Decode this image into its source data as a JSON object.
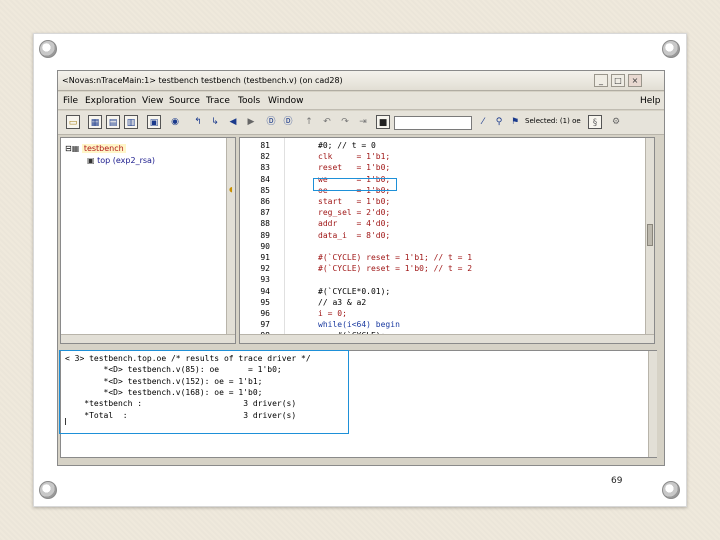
{
  "slide": {
    "page_number": "69"
  },
  "window": {
    "title": "<Novas:nTraceMain:1> testbench testbench (testbench.v) (on cad28)",
    "controls": [
      "_",
      "□",
      "×"
    ]
  },
  "menubar": {
    "items": [
      {
        "label": "File"
      },
      {
        "label": "Exploration"
      },
      {
        "label": "View"
      },
      {
        "label": "Source"
      },
      {
        "label": "Trace"
      },
      {
        "label": "Tools"
      },
      {
        "label": "Window"
      }
    ],
    "help": "Help"
  },
  "toolbar": {
    "selected_label": "Selected: (1) oe",
    "input_value": ""
  },
  "tree": {
    "root": "testbench",
    "child": "top (exp2_rsa)"
  },
  "source": {
    "lines": [
      {
        "num": "81",
        "code": "#0; // t = 0",
        "style": "kw"
      },
      {
        "num": "82",
        "code": "clk     = 1'b1;",
        "style": "red"
      },
      {
        "num": "83",
        "code": "reset   = 1'b0;",
        "style": "red"
      },
      {
        "num": "84",
        "code": "we      = 1'b0;",
        "style": "red"
      },
      {
        "num": "85",
        "code": "oe      = 1'b0;",
        "style": "red"
      },
      {
        "num": "86",
        "code": "start   = 1'b0;",
        "style": "red"
      },
      {
        "num": "87",
        "code": "reg_sel = 2'd0;",
        "style": "red"
      },
      {
        "num": "88",
        "code": "addr    = 4'd0;",
        "style": "red"
      },
      {
        "num": "89",
        "code": "data_i  = 8'd0;",
        "style": "red"
      },
      {
        "num": "90",
        "code": "",
        "style": "kw"
      },
      {
        "num": "91",
        "code": "#(`CYCLE) reset = 1'b1; // t = 1",
        "style": "mix"
      },
      {
        "num": "92",
        "code": "#(`CYCLE) reset = 1'b0; // t = 2",
        "style": "mix"
      },
      {
        "num": "93",
        "code": "",
        "style": "kw"
      },
      {
        "num": "94",
        "code": "#(`CYCLE*0.01);",
        "style": "kw"
      },
      {
        "num": "95",
        "code": "// a3 & a2",
        "style": "kw"
      },
      {
        "num": "96",
        "code": "i = 0;",
        "style": "red"
      },
      {
        "num": "97",
        "code": "while(i<64) begin",
        "style": "blu"
      },
      {
        "num": "98",
        "code": "    #(`CYCLE);",
        "style": "kw"
      }
    ]
  },
  "console": {
    "lines": [
      "< 3> testbench.top.oe /* results of trace driver */",
      "        *<D> testbench.v(85): oe      = 1'b0;",
      "        *<D> testbench.v(152): oe = 1'b1;",
      "        *<D> testbench.v(168): oe = 1'b0;",
      "    *testbench :                     3 driver(s)",
      "    *Total  :                        3 driver(s)"
    ]
  },
  "colors": {
    "highlight": "#1e90d8",
    "code_red": "#a01818",
    "code_blue": "#1a3aa0"
  }
}
